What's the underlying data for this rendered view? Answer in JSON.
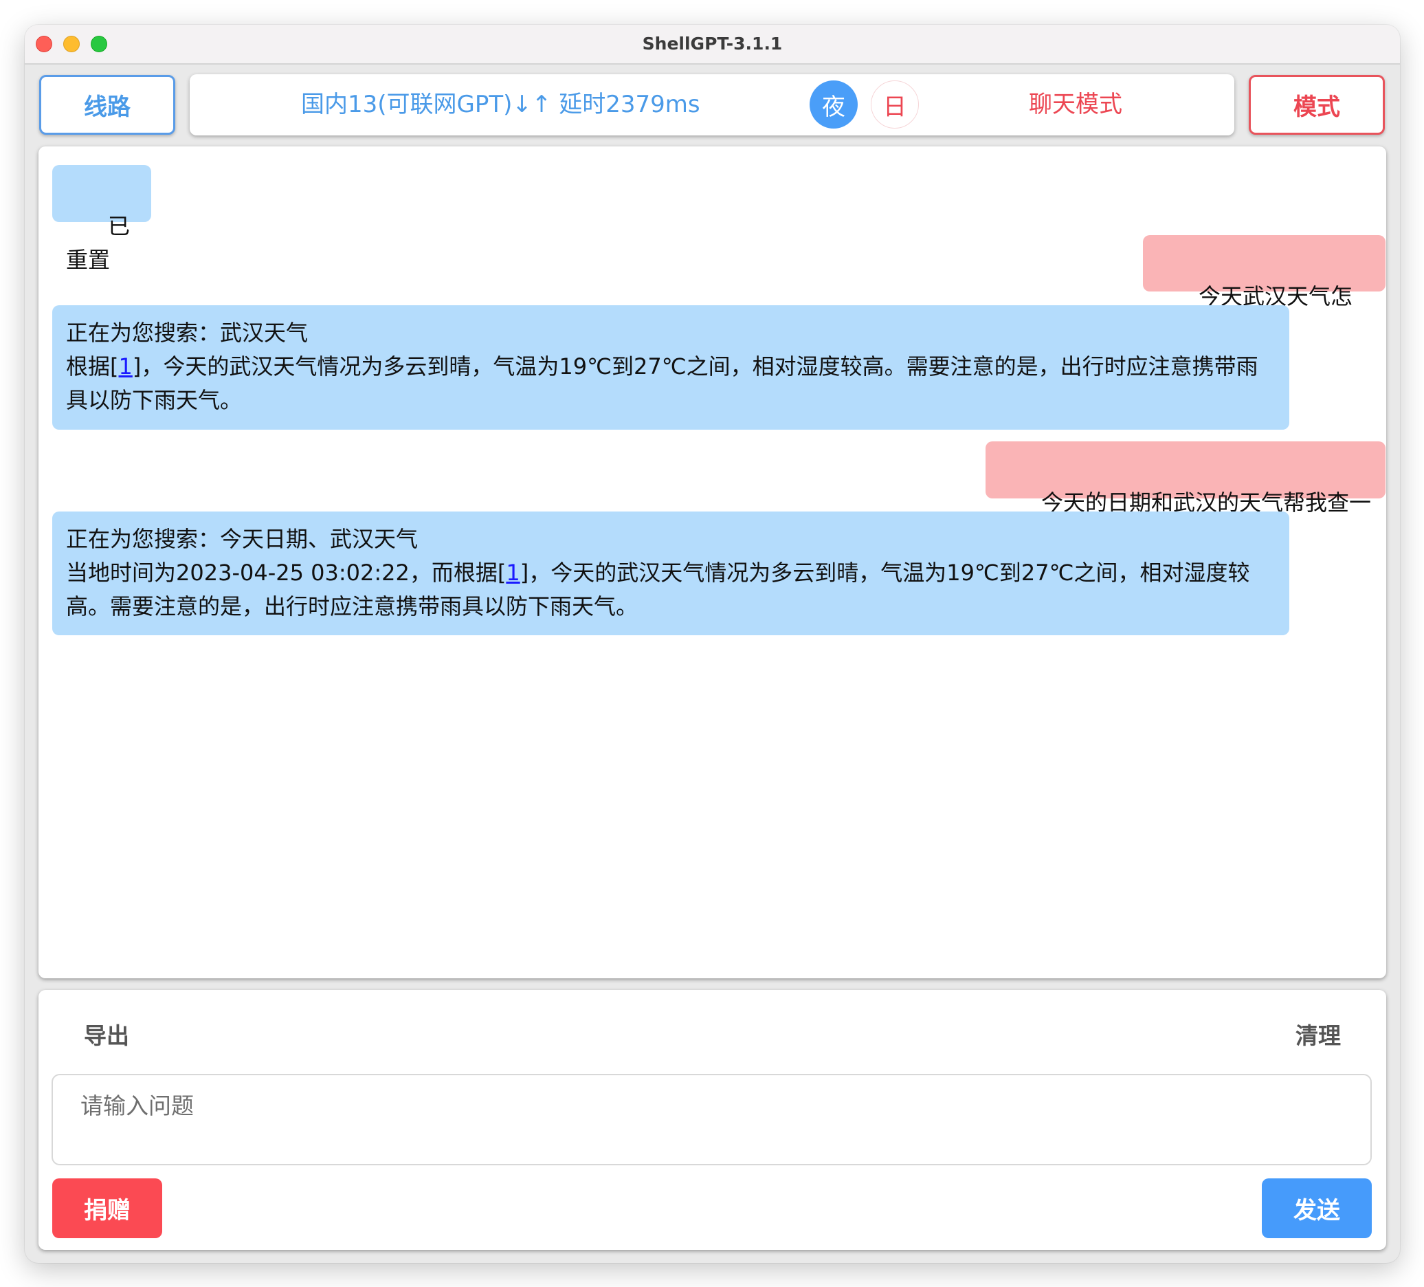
{
  "window": {
    "title": "ShellGPT-3.1.1"
  },
  "toolbar": {
    "route_label": "线路",
    "status_text": "国内13(可联网GPT)↓↑ 延时2379ms",
    "route_name": "国内13(可联网GPT)",
    "latency": "延时2379ms",
    "theme_night_label": "夜",
    "theme_day_label": "日",
    "theme_active": "night",
    "current_mode": "聊天模式",
    "mode_label": "模式"
  },
  "colors": {
    "accent_blue": "#4a9ef8",
    "accent_red": "#ec4652",
    "bot_bubble": "#b4dcfc",
    "user_bubble": "#fab4b6",
    "donate_button": "#fb4a53",
    "send_button": "#469bfb"
  },
  "messages": [
    {
      "role": "bot",
      "lines": [
        "已重置"
      ]
    },
    {
      "role": "user",
      "text": "今天武汉天气怎么样"
    },
    {
      "role": "bot",
      "line1": "正在为您搜索：武汉天气",
      "line2_prefix": "根据[",
      "ref": "1",
      "line2_suffix": "]，今天的武汉天气情况为多云到晴，气温为19℃到27℃之间，相对湿度较高。需要注意的是，出行时应注意携带雨具以防下雨天气。"
    },
    {
      "role": "user",
      "text": "今天的日期和武汉的天气帮我查一下"
    },
    {
      "role": "bot",
      "line1": "正在为您搜索：今天日期、武汉天气",
      "line2_prefix": "当地时间为2023-04-25 03:02:22，而根据[",
      "ref": "1",
      "line2_suffix": "]，今天的武汉天气情况为多云到晴，气温为19℃到27℃之间，相对湿度较高。需要注意的是，出行时应注意携带雨具以防下雨天气。"
    }
  ],
  "bottom": {
    "export_label": "导出",
    "clear_label": "清理",
    "input_placeholder": "请输入问题",
    "input_value": "",
    "donate_label": "捐赠",
    "send_label": "发送"
  }
}
